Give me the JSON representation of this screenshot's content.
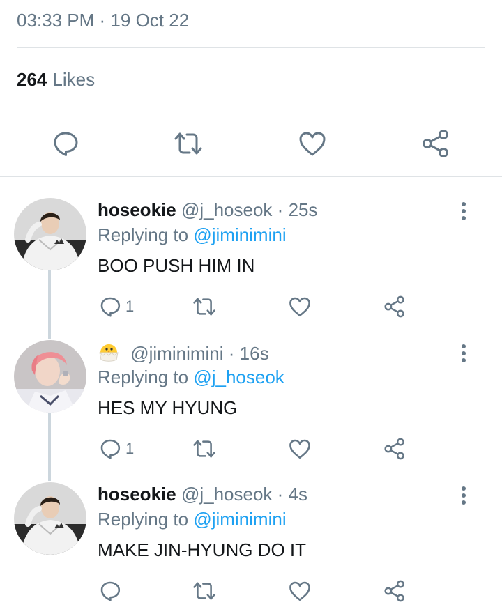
{
  "tweet": {
    "time": "03:33 PM",
    "date": "19 Oct 22",
    "likes_count": "264",
    "likes_label": "Likes"
  },
  "icons": {
    "reply": "reply-bubble-icon",
    "retweet": "retweet-icon",
    "like": "heart-icon",
    "share": "share-icon",
    "more": "vertical-dots-icon"
  },
  "colors": {
    "secondary_text": "#657786",
    "primary_text": "#14171a",
    "link": "#1da1f2",
    "divider": "#dfe3e6",
    "icon": "#657786"
  },
  "replies": [
    {
      "display_name": "hoseokie",
      "handle": "@j_hoseok",
      "time": "25s",
      "replying_prefix": "Replying to",
      "replying_to": "@jiminimini",
      "text": "BOO PUSH HIM IN",
      "reply_count": "1"
    },
    {
      "display_name": "",
      "handle": "@jiminimini",
      "time": "16s",
      "replying_prefix": "Replying to",
      "replying_to": "@j_hoseok",
      "text": "HES MY HYUNG",
      "reply_count": "1"
    },
    {
      "display_name": "hoseokie",
      "handle": "@j_hoseok",
      "time": "4s",
      "replying_prefix": "Replying to",
      "replying_to": "@jiminimini",
      "text": "MAKE JIN-HYUNG DO IT",
      "reply_count": ""
    }
  ]
}
